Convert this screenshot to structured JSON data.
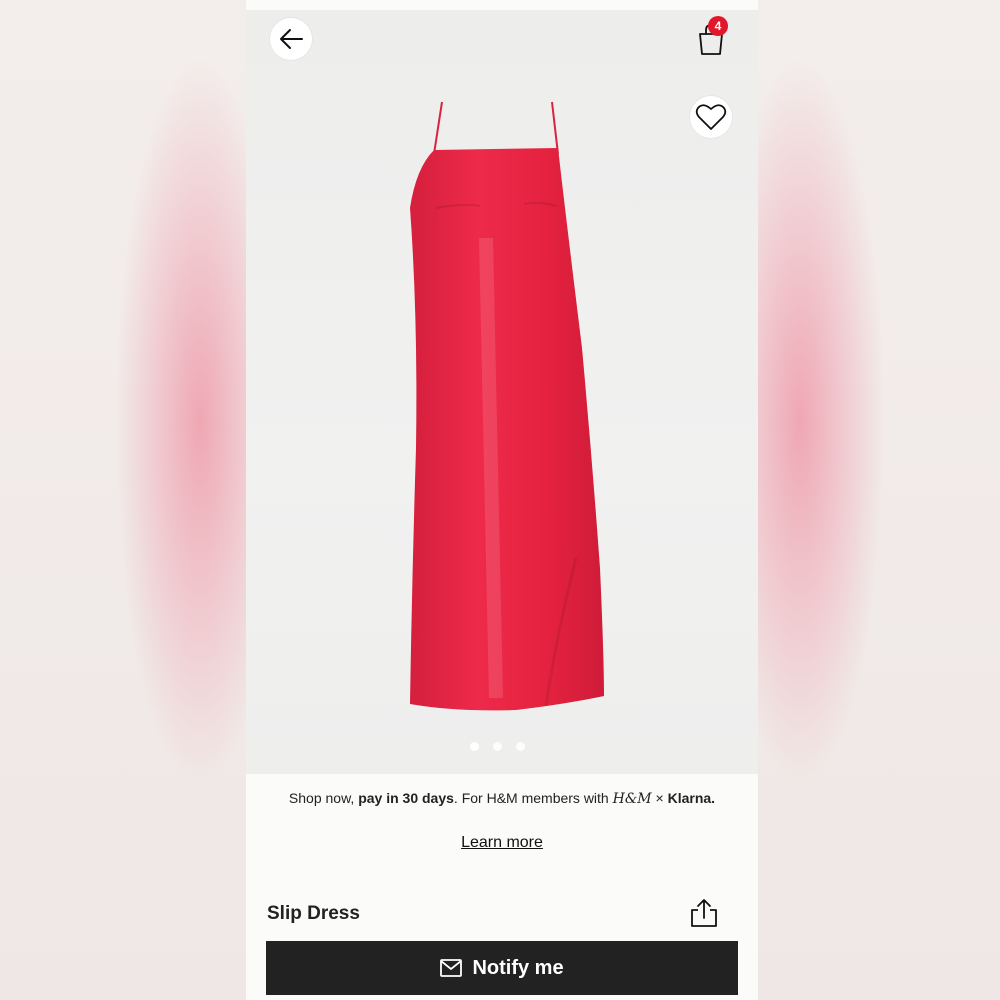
{
  "header": {
    "back_icon": "arrow-left-icon",
    "cart_icon": "shopping-bag-icon",
    "cart_count": "4",
    "favorite_icon": "heart-icon"
  },
  "gallery": {
    "image": "red slip dress",
    "image_count": 3,
    "active_index": 0
  },
  "promo": {
    "text_prefix": "Shop now, ",
    "text_bold": "pay in 30 days",
    "text_suffix": ". For H&M members with ",
    "hm_logo": "H&M",
    "times": " × ",
    "klarna": "Klarna.",
    "learn_more": "Learn more"
  },
  "product": {
    "title": "Slip Dress",
    "share_icon": "share-icon"
  },
  "cta": {
    "icon": "envelope-icon",
    "label": "Notify me"
  },
  "colors": {
    "dress": "#e3213f",
    "cta_bg": "#222222",
    "badge": "#e2182a"
  }
}
